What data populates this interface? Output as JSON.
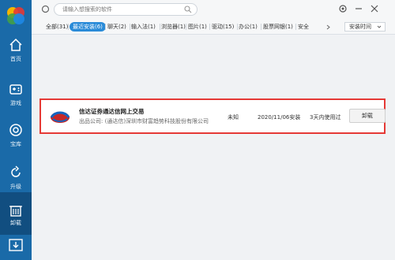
{
  "sidebar": {
    "items": [
      {
        "label": "首页",
        "icon": "home-icon"
      },
      {
        "label": "游戏",
        "icon": "gamepad-icon"
      },
      {
        "label": "宝库",
        "icon": "treasure-icon"
      },
      {
        "label": "升级",
        "icon": "upgrade-icon"
      },
      {
        "label": "卸载",
        "icon": "uninstall-icon"
      }
    ],
    "active_index": 4,
    "bottom_icon": "download-icon"
  },
  "search": {
    "placeholder": "请输入想搜索的软件"
  },
  "tabs": [
    {
      "label": "全部(31)"
    },
    {
      "label": "最近安装(6)"
    },
    {
      "label": "聊天(2)"
    },
    {
      "label": "输入法(1)"
    },
    {
      "label": "浏览器(1)"
    },
    {
      "label": "图片(1)"
    },
    {
      "label": "驱动(15)"
    },
    {
      "label": "办公(1)"
    },
    {
      "label": "股票网银(1)"
    },
    {
      "label": "安全"
    }
  ],
  "active_tab": 1,
  "sort": {
    "label": "安装时间"
  },
  "app": {
    "name": "信达证券通达信网上交易",
    "publisher": "出品公司: (通达信)深圳市财富趋势科技股份有限公司",
    "size": "未知",
    "install_date": "2020/11/06安装",
    "usage": "3天内使用过",
    "uninstall_label": "卸载"
  },
  "colors": {
    "sidebar": "#1a6aa8",
    "accent": "#2a8bd8",
    "highlight": "#e53935"
  }
}
